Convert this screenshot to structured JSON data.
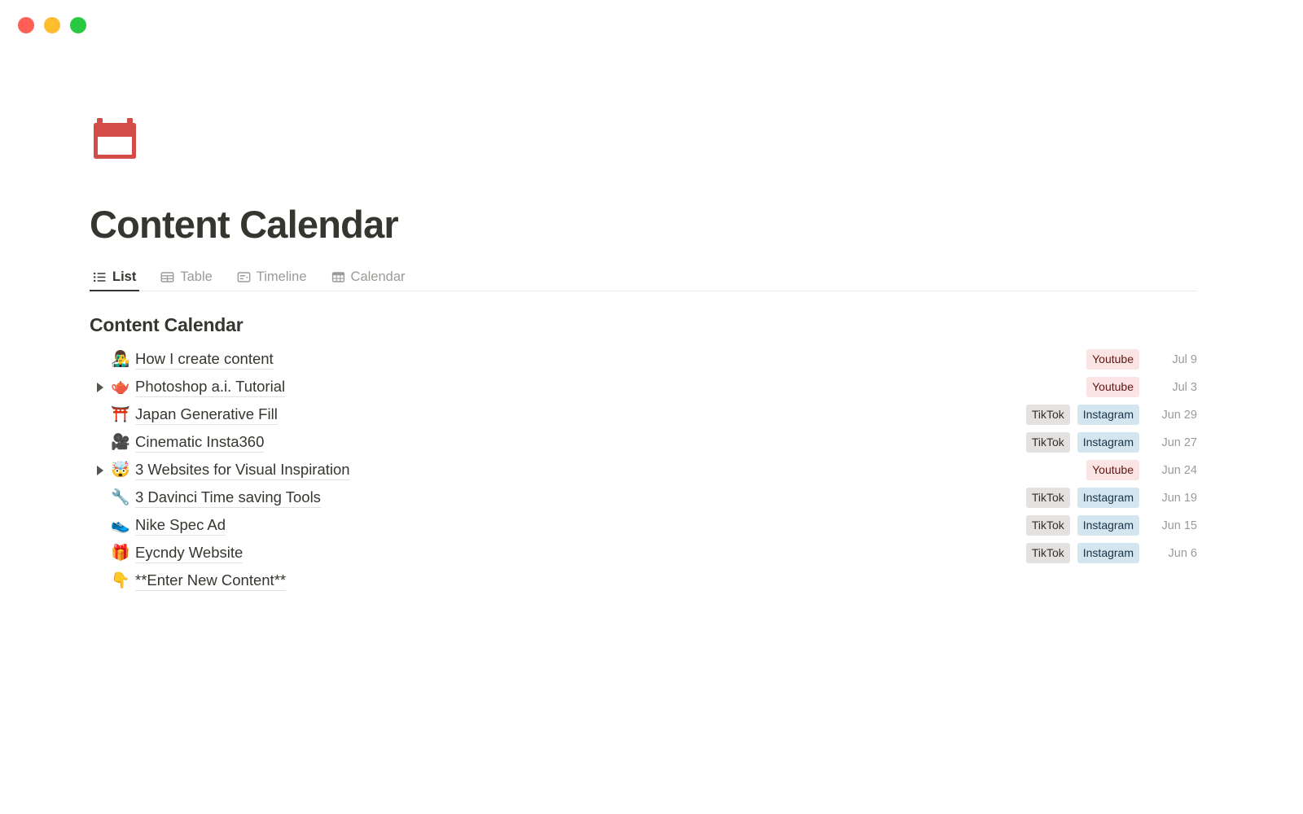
{
  "window": {
    "controls": [
      {
        "name": "close",
        "color": "#ff5f57"
      },
      {
        "name": "minimize",
        "color": "#febc2e"
      },
      {
        "name": "maximize",
        "color": "#28c840"
      }
    ]
  },
  "page": {
    "icon": "calendar-icon",
    "icon_color": "#d44c47",
    "title": "Content Calendar"
  },
  "tabs": [
    {
      "label": "List",
      "icon": "list-icon",
      "active": true
    },
    {
      "label": "Table",
      "icon": "table-icon",
      "active": false
    },
    {
      "label": "Timeline",
      "icon": "timeline-icon",
      "active": false
    },
    {
      "label": "Calendar",
      "icon": "calendar-view-icon",
      "active": false
    }
  ],
  "list": {
    "group_title": "Content Calendar",
    "items": [
      {
        "emoji": "👨‍🎤",
        "emoji_name": "artist-emoji",
        "title": "How I create content",
        "has_toggle": false,
        "tags": [
          {
            "label": "Youtube",
            "style": "youtube"
          }
        ],
        "date": "Jul 9"
      },
      {
        "emoji": "🫖",
        "emoji_name": "robot-cupcake-emoji",
        "title": "Photoshop a.i. Tutorial",
        "has_toggle": true,
        "tags": [
          {
            "label": "Youtube",
            "style": "youtube"
          }
        ],
        "date": "Jul 3"
      },
      {
        "emoji": "⛩️",
        "emoji_name": "torii-gate-emoji",
        "title": "Japan Generative Fill",
        "has_toggle": false,
        "tags": [
          {
            "label": "TikTok",
            "style": "tiktok"
          },
          {
            "label": "Instagram",
            "style": "instagram"
          }
        ],
        "date": "Jun 29"
      },
      {
        "emoji": "🎥",
        "emoji_name": "movie-camera-emoji",
        "title": "Cinematic Insta360",
        "has_toggle": false,
        "tags": [
          {
            "label": "TikTok",
            "style": "tiktok"
          },
          {
            "label": "Instagram",
            "style": "instagram"
          }
        ],
        "date": "Jun 27"
      },
      {
        "emoji": "🤯",
        "emoji_name": "exploding-head-emoji",
        "title": "3 Websites for Visual Inspiration",
        "has_toggle": true,
        "tags": [
          {
            "label": "Youtube",
            "style": "youtube"
          }
        ],
        "date": "Jun 24"
      },
      {
        "emoji": "🔧",
        "emoji_name": "wrench-emoji",
        "title": "3 Davinci Time saving Tools",
        "has_toggle": false,
        "tags": [
          {
            "label": "TikTok",
            "style": "tiktok"
          },
          {
            "label": "Instagram",
            "style": "instagram"
          }
        ],
        "date": "Jun 19"
      },
      {
        "emoji": "👟",
        "emoji_name": "running-shoe-emoji",
        "title": "Nike Spec Ad",
        "has_toggle": false,
        "tags": [
          {
            "label": "TikTok",
            "style": "tiktok"
          },
          {
            "label": "Instagram",
            "style": "instagram"
          }
        ],
        "date": "Jun 15"
      },
      {
        "emoji": "🎁",
        "emoji_name": "gift-emoji",
        "title": "Eycndy Website",
        "has_toggle": false,
        "tags": [
          {
            "label": "TikTok",
            "style": "tiktok"
          },
          {
            "label": "Instagram",
            "style": "instagram"
          }
        ],
        "date": "Jun 6"
      },
      {
        "emoji": "👇",
        "emoji_name": "pointing-down-emoji",
        "title": "**Enter New Content**",
        "has_toggle": false,
        "tags": [],
        "date": ""
      }
    ]
  }
}
